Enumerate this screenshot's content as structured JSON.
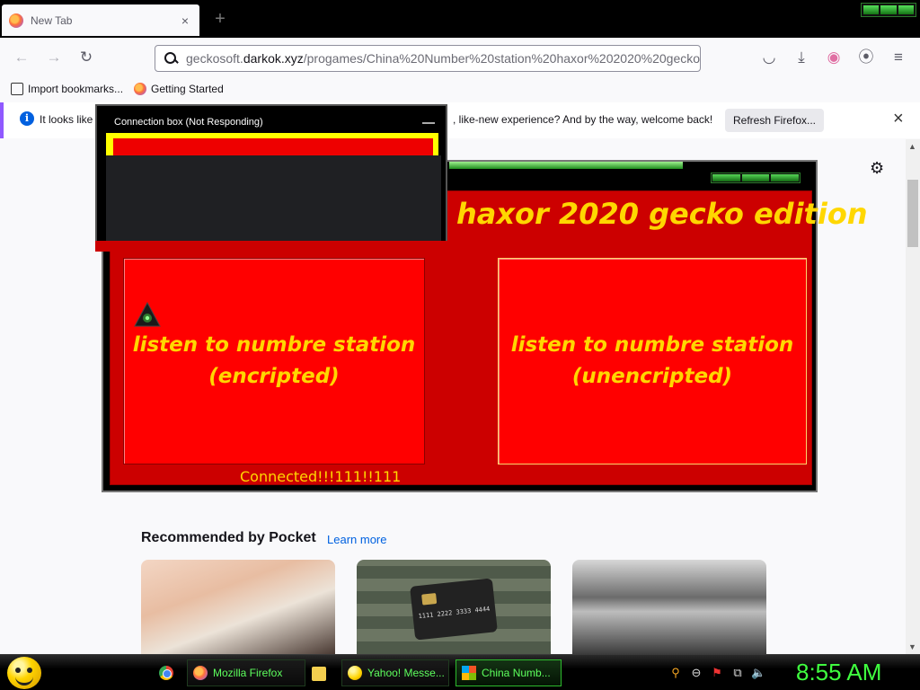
{
  "browser": {
    "tab_title": "New Tab",
    "tab_close": "×",
    "new_tab": "+",
    "url_domain": "geckosoft.darkok.xyz",
    "url_prefix": "geckosoft.",
    "url_host": "darkok.xyz",
    "url_path": "/progames/China%20Number%20station%20haxor%202020%20gecko%",
    "bookmarks": [
      "Import bookmarks...",
      "Getting Started"
    ],
    "notification": {
      "text_left": "It looks like y",
      "text_right": ", like-new experience? And by the way, welcome back!",
      "button": "Refresh Firefox...",
      "close": "×"
    }
  },
  "app": {
    "title": "haxor 2020 gecko edition",
    "button_encrypted": "listen to numbre station (encripted)",
    "button_unencrypted": "listen to numbre station (unencripted)",
    "status": "Connected!!!111!!111"
  },
  "dialog": {
    "title": "Connection box (Not Responding)"
  },
  "pocket": {
    "heading": "Recommended by Pocket",
    "learn_more": "Learn more",
    "card2_text": "1111 2222 3333 4444"
  },
  "taskbar": {
    "items": [
      "Mozilla Firefox",
      "Yahoo! Messe...",
      "China Numb..."
    ],
    "clock": "8:55 AM"
  },
  "colors": {
    "app_red": "#cc0000",
    "app_title_yellow": "#ffd700",
    "taskbar_green": "#3fff3f",
    "firefox_accent": "#9059ff"
  }
}
